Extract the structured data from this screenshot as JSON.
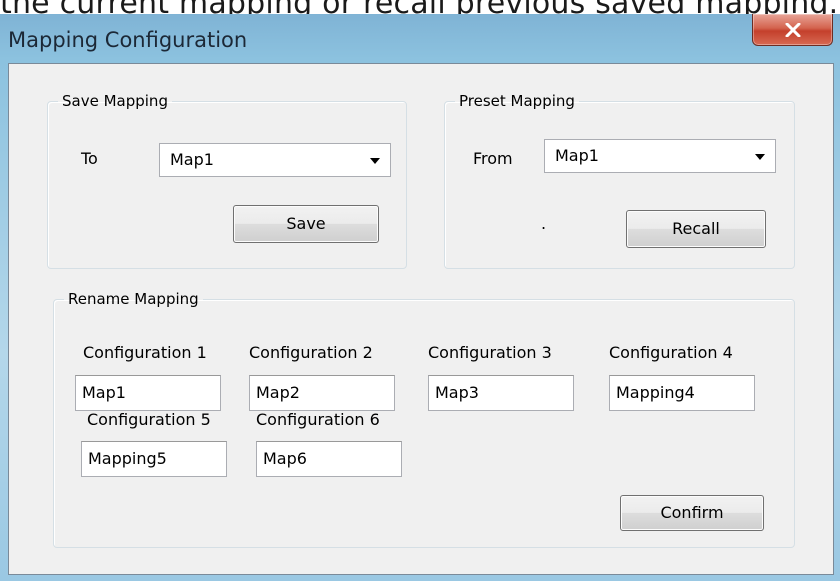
{
  "caption": "the current mapping or recall previous saved mapping.",
  "window": {
    "title": "Mapping Configuration",
    "close_icon": "close-x-icon"
  },
  "save_mapping": {
    "legend": "Save Mapping",
    "to_label": "To",
    "selected": "Map1",
    "save_label": "Save"
  },
  "preset_mapping": {
    "legend": "Preset Mapping",
    "from_label": "From",
    "selected": "Map1",
    "dot": ".",
    "recall_label": "Recall"
  },
  "rename_mapping": {
    "legend": "Rename Mapping",
    "configs": [
      {
        "label": "Configuration 1",
        "value": "Map1"
      },
      {
        "label": "Configuration 2",
        "value": "Map2"
      },
      {
        "label": "Configuration 3",
        "value": "Map3"
      },
      {
        "label": "Configuration 4",
        "value": "Mapping4"
      },
      {
        "label": "Configuration 5",
        "value": "Mapping5"
      },
      {
        "label": "Configuration 6",
        "value": "Map6"
      }
    ],
    "confirm_label": "Confirm"
  },
  "colors": {
    "titlebar": "#8cc2df",
    "close_button": "#c4402c",
    "dialog_bg": "#f0f0f0"
  }
}
